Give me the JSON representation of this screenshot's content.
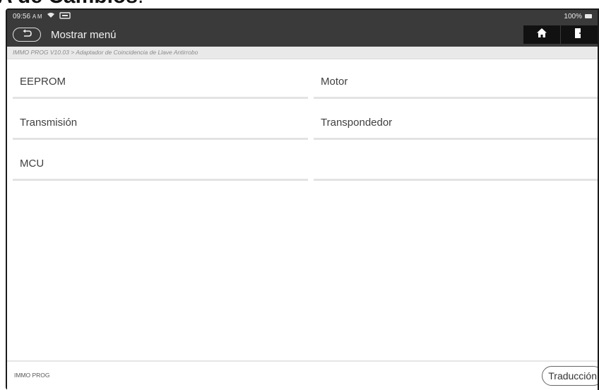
{
  "doc_heading": "A de Cambios",
  "doc_heading_suffix": ".",
  "status": {
    "time": "09:56",
    "ampm": "A M",
    "battery": "100%"
  },
  "header": {
    "title": "Mostrar menú",
    "back_icon": "back-arrow-icon",
    "home_icon": "home-icon",
    "exit_icon": "exit-icon"
  },
  "breadcrumb": "IMMO PROG V10.03 > Adaptador de Coincidencia de Llave Antirrobo",
  "menu": {
    "items": [
      "EEPROM",
      "Motor",
      "Transmisión",
      "Transpondedor",
      "MCU",
      ""
    ]
  },
  "footer": {
    "label": "IMMO PROG",
    "translate_button": "Traducción"
  },
  "colors": {
    "bar": "#3a3a3a",
    "divider": "#e3e3e3"
  }
}
